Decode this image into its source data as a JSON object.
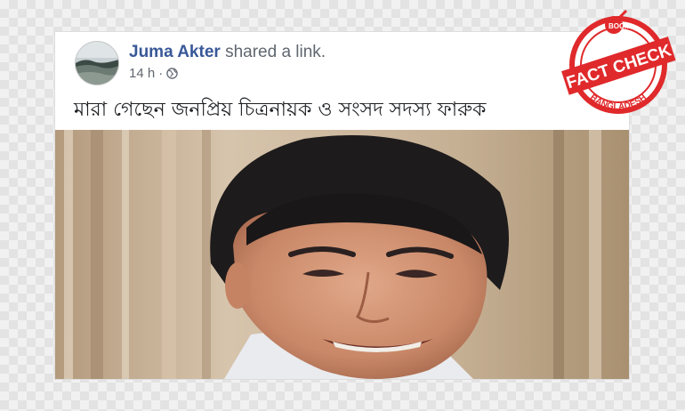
{
  "post": {
    "author_name": "Juma Akter",
    "action_text": "shared a link.",
    "time": "14 h",
    "separator": "·",
    "privacy_icon": "globe-icon",
    "caption": "মারা গেছেন জনপ্রিয় চিত্রনায়ক ও সংসদ সদস্য ফারুক"
  },
  "stamp": {
    "top_text": "BOOM",
    "main_text": "FACT CHECK",
    "bottom_text": "BANGLADESH",
    "color": "#e0292b"
  }
}
